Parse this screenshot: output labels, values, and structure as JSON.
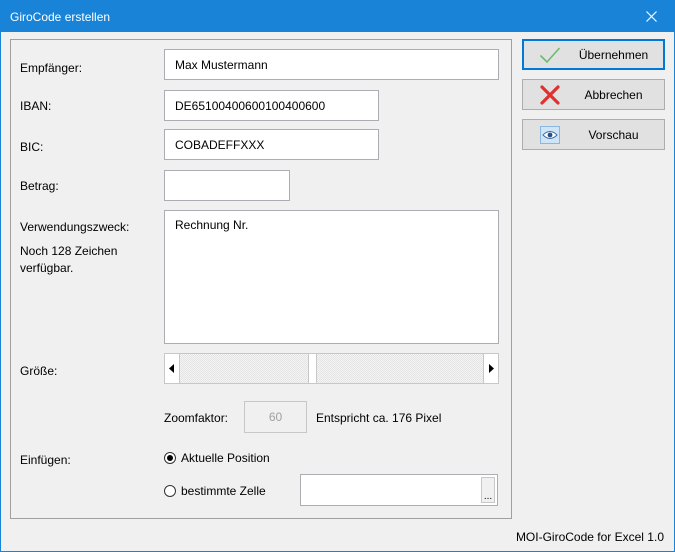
{
  "window": {
    "title": "GiroCode erstellen"
  },
  "form": {
    "recipient": {
      "label": "Empfänger:",
      "value": "Max Mustermann"
    },
    "iban": {
      "label": "IBAN:",
      "value": "DE65100400600100400600"
    },
    "bic": {
      "label": "BIC:",
      "value": "COBADEFFXXX"
    },
    "amount": {
      "label": "Betrag:",
      "value": ""
    },
    "purpose": {
      "label": "Verwendungszweck:",
      "hint_line1": "Noch 128 Zeichen",
      "hint_line2": "verfügbar.",
      "value": "Rechnung Nr."
    },
    "size": {
      "label": "Größe:",
      "level_fraction": 0.44
    },
    "zoom": {
      "label": "Zoomfaktor:",
      "value": "60",
      "info": "Entspricht ca. 176 Pixel"
    },
    "insert": {
      "label": "Einfügen:",
      "options": [
        {
          "label": "Aktuelle Position",
          "selected": true
        },
        {
          "label": "bestimmte Zelle",
          "selected": false
        }
      ],
      "cell_value": "",
      "browse_label": "..."
    }
  },
  "buttons": {
    "apply": {
      "label": "Übernehmen",
      "icon": "check-icon"
    },
    "cancel": {
      "label": "Abbrechen",
      "icon": "x-icon"
    },
    "preview": {
      "label": "Vorschau",
      "icon": "eye-icon"
    }
  },
  "footer": {
    "text": "MOI-GiroCode for Excel 1.0"
  },
  "colors": {
    "titlebar": "#1883d7",
    "accent": "#0078d7",
    "check": "#5cb85c",
    "cancel": "#e03030"
  }
}
